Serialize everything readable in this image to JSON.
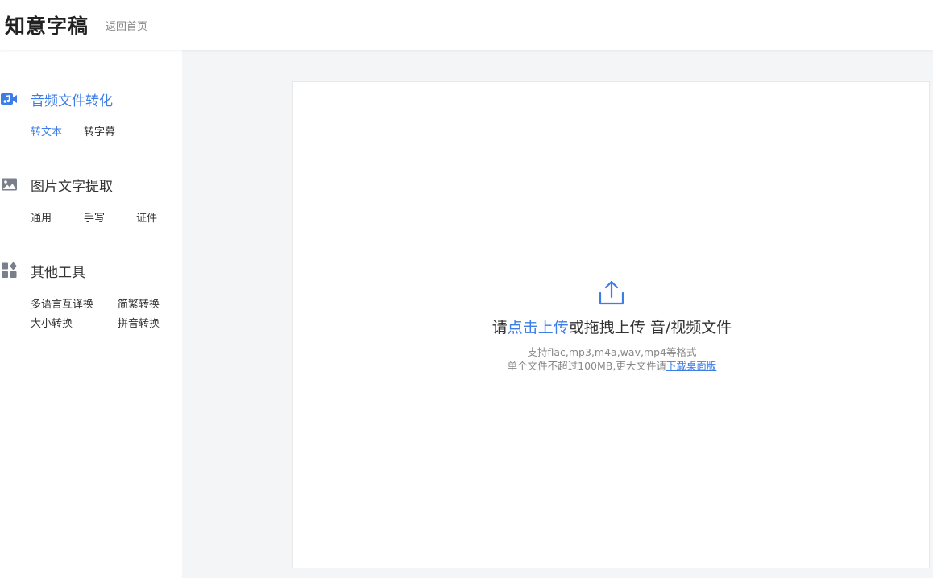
{
  "header": {
    "logo": "知意字稿",
    "back_label": "返回首页"
  },
  "sidebar": {
    "groups": [
      {
        "title": "音频文件转化",
        "icon": "music-video-icon",
        "active": true,
        "items": [
          "转文本",
          "转字幕"
        ]
      },
      {
        "title": "图片文字提取",
        "icon": "image-icon",
        "active": false,
        "items": [
          "通用",
          "手写",
          "证件"
        ]
      },
      {
        "title": "其他工具",
        "icon": "apps-icon",
        "active": false,
        "items": [
          "多语言互译换",
          "简繁转换",
          "大小转换",
          "拼音转换"
        ]
      }
    ]
  },
  "upload": {
    "prefix": "请",
    "click_link": "点击上传",
    "suffix": "或拖拽上传 音/视频文件",
    "formats_hint": "支持flac,mp3,m4a,wav,mp4等格式",
    "size_hint": "单个文件不超过100MB,更大文件请",
    "download_link": "下载桌面版"
  },
  "colors": {
    "accent": "#3d7de8",
    "background": "#f4f5f7",
    "icon_gray": "#7a7f8c"
  }
}
